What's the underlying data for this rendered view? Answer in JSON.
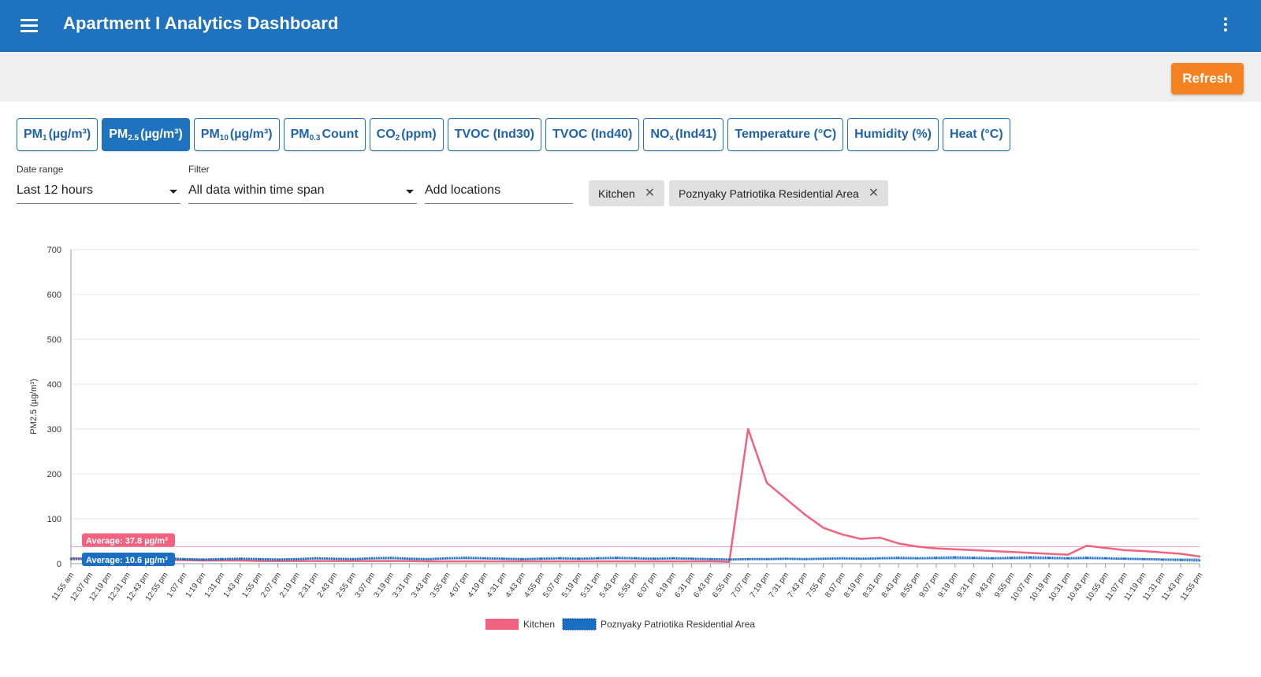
{
  "app": {
    "title": "Apartment I Analytics Dashboard"
  },
  "toolbar": {
    "refresh_label": "Refresh"
  },
  "tabs": [
    {
      "base": "PM",
      "sub": "1",
      "rest": "(µg/m³)",
      "active": false
    },
    {
      "base": "PM",
      "sub": "2.5",
      "rest": "(µg/m³)",
      "active": true
    },
    {
      "base": "PM",
      "sub": "10",
      "rest": "(µg/m³)",
      "active": false
    },
    {
      "base": "PM",
      "sub": "0.3",
      "rest": "Count",
      "active": false
    },
    {
      "base": "CO",
      "sub": "2",
      "rest": "(ppm)",
      "active": false
    },
    {
      "base": "TVOC (Ind30)",
      "sub": "",
      "rest": "",
      "active": false
    },
    {
      "base": "TVOC (Ind40)",
      "sub": "",
      "rest": "",
      "active": false
    },
    {
      "base": "NO",
      "sub": "x",
      "rest": "(Ind41)",
      "active": false
    },
    {
      "base": "Temperature (°C)",
      "sub": "",
      "rest": "",
      "active": false
    },
    {
      "base": "Humidity (%)",
      "sub": "",
      "rest": "",
      "active": false
    },
    {
      "base": "Heat (°C)",
      "sub": "",
      "rest": "",
      "active": false
    }
  ],
  "filters": {
    "date_range": {
      "label": "Date range",
      "value": "Last 12 hours"
    },
    "filter": {
      "label": "Filter",
      "value": "All data within time span"
    },
    "locations": {
      "placeholder": "Add locations"
    }
  },
  "chips": [
    {
      "label": "Kitchen"
    },
    {
      "label": "Poznyaky Patriotika Residential Area"
    }
  ],
  "colors": {
    "primary": "#1f72bd",
    "accent": "#f58220",
    "kitchen": "#f0627f",
    "area": "#1a6fc4"
  },
  "chart_data": {
    "type": "line",
    "ylabel": "PM2.5 (µg/m³)",
    "ylim": [
      0,
      700
    ],
    "yticks": [
      0,
      100,
      200,
      300,
      400,
      500,
      600,
      700
    ],
    "x": [
      "11:55 am",
      "12:07 pm",
      "12:19 pm",
      "12:31 pm",
      "12:43 pm",
      "12:55 pm",
      "1:07 pm",
      "1:19 pm",
      "1:31 pm",
      "1:43 pm",
      "1:55 pm",
      "2:07 pm",
      "2:19 pm",
      "2:31 pm",
      "2:43 pm",
      "2:55 pm",
      "3:07 pm",
      "3:19 pm",
      "3:31 pm",
      "3:43 pm",
      "3:55 pm",
      "4:07 pm",
      "4:19 pm",
      "4:31 pm",
      "4:43 pm",
      "4:55 pm",
      "5:07 pm",
      "5:19 pm",
      "5:31 pm",
      "5:43 pm",
      "5:55 pm",
      "6:07 pm",
      "6:19 pm",
      "6:31 pm",
      "6:43 pm",
      "6:55 pm",
      "7:07 pm",
      "7:19 pm",
      "7:31 pm",
      "7:43 pm",
      "7:55 pm",
      "8:07 pm",
      "8:19 pm",
      "8:31 pm",
      "8:43 pm",
      "8:55 pm",
      "9:07 pm",
      "9:19 pm",
      "9:31 pm",
      "9:43 pm",
      "9:55 pm",
      "10:07 pm",
      "10:19 pm",
      "10:31 pm",
      "10:43 pm",
      "10:55 pm",
      "11:07 pm",
      "11:19 pm",
      "11:31 pm",
      "11:43 pm",
      "11:55 pm"
    ],
    "series": [
      {
        "name": "Kitchen",
        "color": "#f0627f",
        "style": "solid",
        "average": 37.8,
        "average_label": "Average: 37.8 µg/m³",
        "values": [
          12,
          11,
          10,
          9,
          9,
          8,
          8,
          7,
          7,
          7,
          6,
          6,
          6,
          6,
          6,
          6,
          6,
          6,
          6,
          5,
          5,
          5,
          5,
          5,
          5,
          5,
          5,
          5,
          5,
          5,
          5,
          5,
          5,
          5,
          5,
          4,
          300,
          180,
          145,
          110,
          80,
          65,
          55,
          58,
          45,
          38,
          34,
          32,
          30,
          28,
          26,
          24,
          22,
          20,
          40,
          35,
          30,
          28,
          25,
          22,
          16
        ]
      },
      {
        "name": "Poznyaky Patriotika Residential Area",
        "color": "#1a6fc4",
        "style": "dotted",
        "average": 10.6,
        "average_label": "Average: 10.6 µg/m³",
        "values": [
          10,
          11,
          12,
          11,
          10,
          12,
          10,
          9,
          10,
          11,
          10,
          9,
          10,
          12,
          11,
          10,
          12,
          13,
          11,
          10,
          12,
          13,
          12,
          11,
          10,
          11,
          12,
          11,
          12,
          13,
          12,
          11,
          12,
          11,
          10,
          9,
          10,
          10,
          11,
          10,
          11,
          12,
          11,
          12,
          13,
          12,
          13,
          14,
          13,
          12,
          13,
          14,
          13,
          12,
          13,
          12,
          11,
          10,
          9,
          8,
          7
        ]
      }
    ],
    "legend": "bottom-center",
    "grid": true
  }
}
